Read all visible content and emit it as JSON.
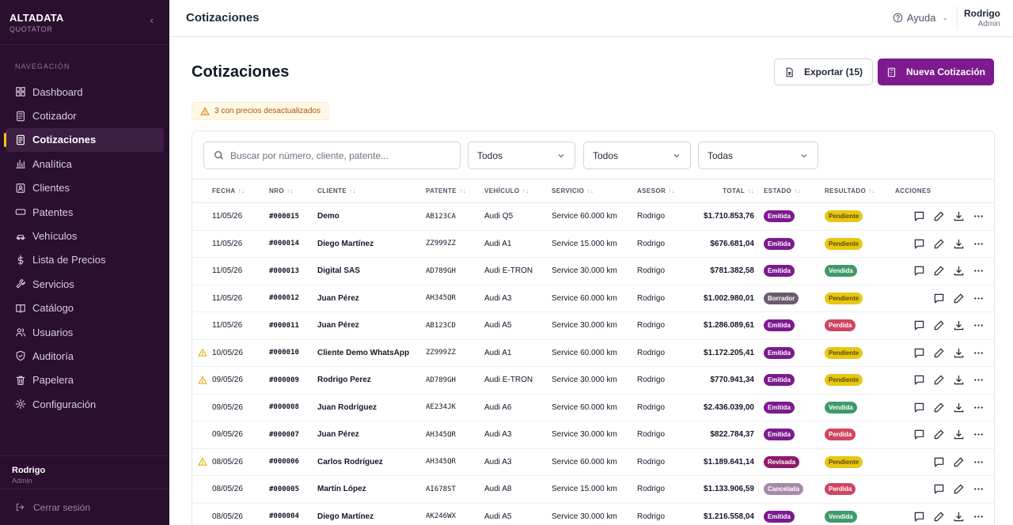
{
  "brand": {
    "name": "ALTADATA",
    "sub": "QUOTATOR"
  },
  "sidebar": {
    "heading": "NAVEGACIÓN",
    "items": [
      {
        "label": "Dashboard",
        "icon": "grid-icon"
      },
      {
        "label": "Cotizador",
        "icon": "calculator-icon"
      },
      {
        "label": "Cotizaciones",
        "icon": "document-icon",
        "active": true
      },
      {
        "label": "Analítica",
        "icon": "bar-chart-icon"
      },
      {
        "label": "Clientes",
        "icon": "contact-card-icon"
      },
      {
        "label": "Patentes",
        "icon": "license-plate-icon"
      },
      {
        "label": "Vehículos",
        "icon": "car-icon"
      },
      {
        "label": "Lista de Precios",
        "icon": "dollar-icon"
      },
      {
        "label": "Servicios",
        "icon": "wrench-icon"
      },
      {
        "label": "Catálogo",
        "icon": "book-icon"
      },
      {
        "label": "Usuarios",
        "icon": "users-icon"
      },
      {
        "label": "Auditoría",
        "icon": "shield-icon"
      },
      {
        "label": "Papelera",
        "icon": "trash-icon"
      },
      {
        "label": "Configuración",
        "icon": "gear-icon"
      }
    ],
    "user": {
      "name": "Rodrigo",
      "role": "Admin"
    },
    "logout": "Cerrar sesión"
  },
  "topbar": {
    "title": "Cotizaciones",
    "help": "Ayuda",
    "user": {
      "name": "Rodrigo",
      "role": "Admin"
    }
  },
  "page": {
    "title": "Cotizaciones",
    "export_label": "Exportar (15)",
    "new_label": "Nueva Cotización",
    "warning": "3 con precios desactualizados"
  },
  "filters": {
    "search_placeholder": "Buscar por número, cliente, patente...",
    "selects": [
      "Todos",
      "Todos",
      "Todas"
    ]
  },
  "table": {
    "headers": [
      "",
      "FECHA",
      "NRO",
      "CLIENTE",
      "PATENTE",
      "VEHÍCULO",
      "SERVICIO",
      "ASESOR",
      "TOTAL",
      "ESTADO",
      "RESULTADO",
      "ACCIONES"
    ],
    "rows": [
      {
        "warn": false,
        "fecha": "11/05/26",
        "nro": "#000015",
        "cliente": "Demo",
        "patente": "AB123CA",
        "vehiculo": "Audi Q5",
        "servicio": "Service 60.000 km",
        "asesor": "Rodrigo",
        "total": "$1.710.853,76",
        "estado": "Emitida",
        "resultado": "Pendiente",
        "download": true
      },
      {
        "warn": false,
        "fecha": "11/05/26",
        "nro": "#000014",
        "cliente": "Diego Martínez",
        "patente": "ZZ999ZZ",
        "vehiculo": "Audi A1",
        "servicio": "Service 15.000 km",
        "asesor": "Rodrigo",
        "total": "$676.681,04",
        "estado": "Emitida",
        "resultado": "Pendiente",
        "download": true
      },
      {
        "warn": false,
        "fecha": "11/05/26",
        "nro": "#000013",
        "cliente": "Digital SAS",
        "patente": "AD789GH",
        "vehiculo": "Audi E-TRON",
        "servicio": "Service 30.000 km",
        "asesor": "Rodrigo",
        "total": "$781.382,58",
        "estado": "Emitida",
        "resultado": "Vendida",
        "download": true
      },
      {
        "warn": false,
        "fecha": "11/05/26",
        "nro": "#000012",
        "cliente": "Juan Pérez",
        "patente": "AH345QR",
        "vehiculo": "Audi A3",
        "servicio": "Service 60.000 km",
        "asesor": "Rodrigo",
        "total": "$1.002.980,01",
        "estado": "Borrador",
        "resultado": "Pendiente",
        "download": false
      },
      {
        "warn": false,
        "fecha": "11/05/26",
        "nro": "#000011",
        "cliente": "Juan Pérez",
        "patente": "AB123CD",
        "vehiculo": "Audi A5",
        "servicio": "Service 30.000 km",
        "asesor": "Rodrigo",
        "total": "$1.286.089,61",
        "estado": "Emitida",
        "resultado": "Perdida",
        "download": true
      },
      {
        "warn": true,
        "fecha": "10/05/26",
        "nro": "#000010",
        "cliente": "Cliente Demo WhatsApp",
        "patente": "ZZ999ZZ",
        "vehiculo": "Audi A1",
        "servicio": "Service 60.000 km",
        "asesor": "Rodrigo",
        "total": "$1.172.205,41",
        "estado": "Emitida",
        "resultado": "Pendiente",
        "download": true
      },
      {
        "warn": true,
        "fecha": "09/05/26",
        "nro": "#000009",
        "cliente": "Rodrigo Perez",
        "patente": "AD789GH",
        "vehiculo": "Audi E-TRON",
        "servicio": "Service 30.000 km",
        "asesor": "Rodrigo",
        "total": "$770.941,34",
        "estado": "Emitida",
        "resultado": "Pendiente",
        "download": true
      },
      {
        "warn": false,
        "fecha": "09/05/26",
        "nro": "#000008",
        "cliente": "Juan Rodríguez",
        "patente": "AE234JK",
        "vehiculo": "Audi A6",
        "servicio": "Service 60.000 km",
        "asesor": "Rodrigo",
        "total": "$2.436.039,00",
        "estado": "Emitida",
        "resultado": "Vendida",
        "download": true
      },
      {
        "warn": false,
        "fecha": "09/05/26",
        "nro": "#000007",
        "cliente": "Juan Pérez",
        "patente": "AH345QR",
        "vehiculo": "Audi A3",
        "servicio": "Service 30.000 km",
        "asesor": "Rodrigo",
        "total": "$822.784,37",
        "estado": "Emitida",
        "resultado": "Perdida",
        "download": true
      },
      {
        "warn": true,
        "fecha": "08/05/26",
        "nro": "#000006",
        "cliente": "Carlos Rodríguez",
        "patente": "AH345QR",
        "vehiculo": "Audi A3",
        "servicio": "Service 60.000 km",
        "asesor": "Rodrigo",
        "total": "$1.189.641,14",
        "estado": "Revisada",
        "resultado": "Pendiente",
        "download": false
      },
      {
        "warn": false,
        "fecha": "08/05/26",
        "nro": "#000005",
        "cliente": "Martín López",
        "patente": "AI678ST",
        "vehiculo": "Audi A8",
        "servicio": "Service 15.000 km",
        "asesor": "Rodrigo",
        "total": "$1.133.906,59",
        "estado": "Cancelada",
        "resultado": "Perdida",
        "download": false
      },
      {
        "warn": false,
        "fecha": "08/05/26",
        "nro": "#000004",
        "cliente": "Diego Martínez",
        "patente": "AK246WX",
        "vehiculo": "Audi A5",
        "servicio": "Service 30.000 km",
        "asesor": "Rodrigo",
        "total": "$1.216.558,04",
        "estado": "Emitida",
        "resultado": "Vendida",
        "download": true
      }
    ]
  },
  "colors": {
    "sidebar_bg": "#2a0f2e",
    "accent": "#7c1a8e",
    "active_marker": "#f5c518",
    "estado": {
      "Emitida": "#7c1a8e",
      "Borrador": "#6b5b6e",
      "Revisada": "#8e1a6a",
      "Cancelada": "#a58aa8"
    },
    "resultado": {
      "Pendiente": "#e6c813",
      "Vendida": "#3f9a6a",
      "Perdida": "#d0455f"
    }
  }
}
